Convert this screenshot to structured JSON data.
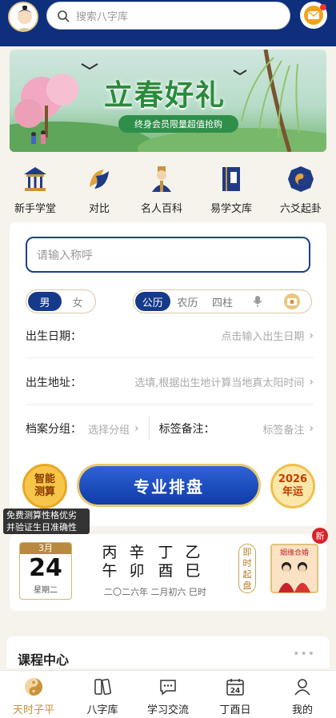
{
  "header": {
    "search_placeholder": "搜索八字库"
  },
  "banner": {
    "title": "立春好礼",
    "subtitle": "终身会员限量超值抢购"
  },
  "quick_links": [
    {
      "label": "新手学堂",
      "icon": "temple-icon"
    },
    {
      "label": "对比",
      "icon": "fish-icon"
    },
    {
      "label": "名人百科",
      "icon": "scholar-icon"
    },
    {
      "label": "易学文库",
      "icon": "book-icon"
    },
    {
      "label": "六爻起卦",
      "icon": "bagua-icon"
    }
  ],
  "form": {
    "name_placeholder": "请输入称呼",
    "gender": {
      "male": "男",
      "female": "女",
      "selected": "男"
    },
    "calendar_types": [
      "公历",
      "农历",
      "四柱"
    ],
    "calendar_selected": "公历",
    "birth_date_label": "出生日期：",
    "birth_date_hint": "点击输入出生日期",
    "birth_place_label": "出生地址：",
    "birth_place_hint": "选填,根据出生地计算当地真太阳时间",
    "group_label": "档案分组：",
    "group_hint": "选择分组",
    "tag_label": "标签备注：",
    "tag_hint": "标签备注"
  },
  "actions": {
    "smart_label_1": "智能",
    "smart_label_2": "测算",
    "tooltip_1": "免费测算性格优劣",
    "tooltip_2": "并验证生日准确性",
    "pro_button": "专业排盘",
    "year_1": "2026",
    "year_2": "年运"
  },
  "date_card": {
    "month": "3月",
    "day": "24",
    "weekday": "星期二",
    "ganzhi_top": [
      "丙",
      "辛",
      "丁",
      "乙"
    ],
    "ganzhi_bottom": [
      "午",
      "卯",
      "酉",
      "巳"
    ],
    "lunar": "二〇二六年 二月初六 巳时",
    "instant_1": "即",
    "instant_2": "时",
    "instant_3": "起",
    "instant_4": "盘",
    "marriage_label": "姻缘合婚",
    "new_badge": "新"
  },
  "course": {
    "title": "课程中心"
  },
  "bottom_nav": [
    {
      "label": "天时子平",
      "icon": "yinyang-icon",
      "active": true
    },
    {
      "label": "八字库",
      "icon": "library-icon",
      "active": false
    },
    {
      "label": "学习交流",
      "icon": "chat-icon",
      "active": false
    },
    {
      "label": "丁酉日",
      "icon": "calendar-icon",
      "active": false
    },
    {
      "label": "我的",
      "icon": "user-icon",
      "active": false
    }
  ],
  "colors": {
    "brand_navy": "#0d2f7c",
    "gold": "#c9923c",
    "banner_green": "#2a8a3c"
  }
}
